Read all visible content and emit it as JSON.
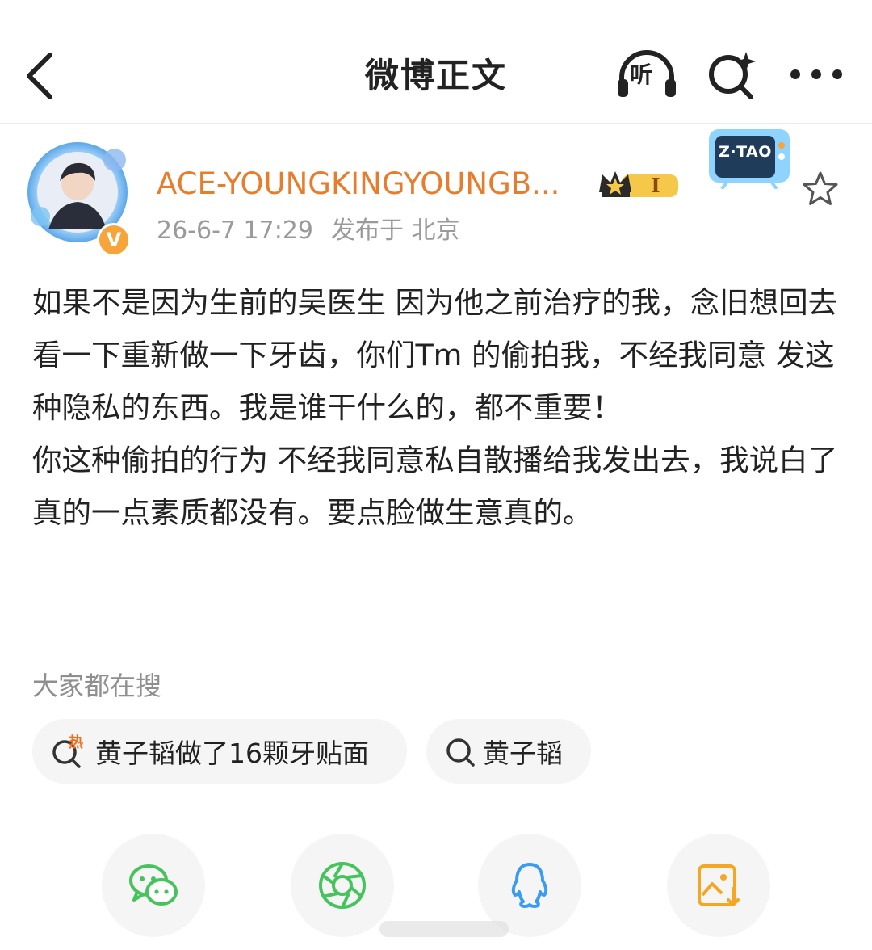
{
  "header": {
    "title": "微博正文",
    "listen_label": "听",
    "icons": [
      "back-arrow-icon",
      "headphones-listen-icon",
      "search-sparkle-icon",
      "more-dots-icon"
    ]
  },
  "post": {
    "username": "ACE-YOUNGKINGYOUNGB...",
    "level_badge": "I",
    "verified_badge": "V",
    "time": "26-6-7 17:29",
    "location_label": "发布于 北京",
    "decoration_tv_text": "Z·TAO",
    "paragraphs": [
      "如果不是因为生前的吴医生 因为他之前治疗的我，念旧想回去看一下重新做一下牙齿，你们Tm 的偷拍我，不经我同意 发这种隐私的东西。我是谁干什么的，都不重要！",
      "你这种偷拍的行为 不经我同意私自散播给我发出去，我说白了真的一点素质都没有。要点脸做生意真的。"
    ]
  },
  "trending": {
    "label": "大家都在搜",
    "hot_tag": "热",
    "chips": [
      "黄子韬做了16颗牙贴面",
      "黄子韬"
    ]
  },
  "share": {
    "icons": [
      "wechat-icon",
      "moments-icon",
      "qq-icon",
      "save-image-icon"
    ],
    "colors": {
      "wechat": "#46c35d",
      "moments": "#46c35d",
      "qq": "#3a9bf2",
      "save": "#f5a623"
    }
  },
  "colors": {
    "username": "#e87c2d",
    "meta": "#9a9a9a",
    "accent_orange": "#f7a43a"
  }
}
